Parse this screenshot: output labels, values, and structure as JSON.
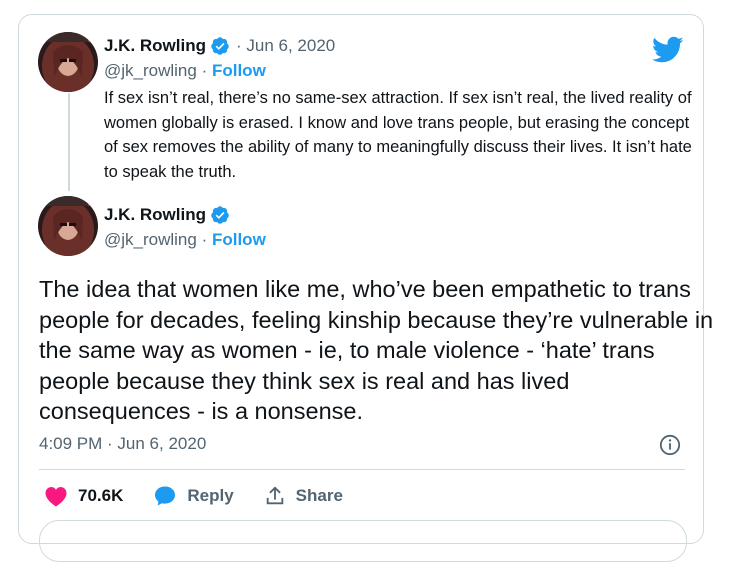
{
  "quoted_tweet": {
    "author_name": "J.K. Rowling",
    "date": "· Jun 6, 2020",
    "handle": "@jk_rowling ·",
    "follow_label": "Follow",
    "text": "If sex isn’t real, there’s no same-sex attraction. If sex isn’t real, the lived reality of women globally is erased. I know and love trans people, but erasing the concept of sex removes the ability of many to meaningfully discuss their lives. It isn’t hate to speak the truth."
  },
  "main_tweet": {
    "author_name": "J.K. Rowling",
    "handle": "@jk_rowling ·",
    "follow_label": "Follow",
    "text": "The idea that women like me, who’ve been empathetic to trans people for decades, feeling kinship because they’re vulnerable in the same way as women - ie, to male violence - ‘hate’ trans people because they think sex is real and has lived consequences - is a nonsense.",
    "timestamp": "4:09 PM · Jun 6, 2020"
  },
  "actions": {
    "like_count": "70.6K",
    "reply_label": "Reply",
    "share_label": "Share"
  },
  "icons": {
    "logo": "twitter-bird-icon",
    "verified": "verified-badge-icon",
    "info": "info-icon",
    "like": "heart-icon",
    "reply": "speech-bubble-icon",
    "share": "share-upload-icon"
  },
  "colors": {
    "brand": "#1d9bf0",
    "like": "#f91880",
    "text": "#0f1419",
    "muted": "#536471",
    "border": "#cfd9de"
  }
}
